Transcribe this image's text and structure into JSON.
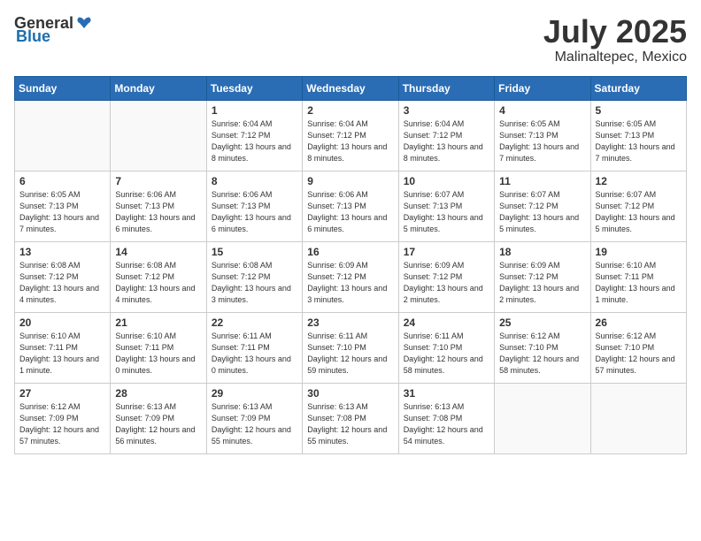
{
  "logo": {
    "general": "General",
    "blue": "Blue"
  },
  "title": "July 2025",
  "location": "Malinaltepec, Mexico",
  "weekdays": [
    "Sunday",
    "Monday",
    "Tuesday",
    "Wednesday",
    "Thursday",
    "Friday",
    "Saturday"
  ],
  "weeks": [
    [
      null,
      null,
      {
        "day": 1,
        "sunrise": "6:04 AM",
        "sunset": "7:12 PM",
        "daylight": "13 hours and 8 minutes."
      },
      {
        "day": 2,
        "sunrise": "6:04 AM",
        "sunset": "7:12 PM",
        "daylight": "13 hours and 8 minutes."
      },
      {
        "day": 3,
        "sunrise": "6:04 AM",
        "sunset": "7:12 PM",
        "daylight": "13 hours and 8 minutes."
      },
      {
        "day": 4,
        "sunrise": "6:05 AM",
        "sunset": "7:13 PM",
        "daylight": "13 hours and 7 minutes."
      },
      {
        "day": 5,
        "sunrise": "6:05 AM",
        "sunset": "7:13 PM",
        "daylight": "13 hours and 7 minutes."
      }
    ],
    [
      {
        "day": 6,
        "sunrise": "6:05 AM",
        "sunset": "7:13 PM",
        "daylight": "13 hours and 7 minutes."
      },
      {
        "day": 7,
        "sunrise": "6:06 AM",
        "sunset": "7:13 PM",
        "daylight": "13 hours and 6 minutes."
      },
      {
        "day": 8,
        "sunrise": "6:06 AM",
        "sunset": "7:13 PM",
        "daylight": "13 hours and 6 minutes."
      },
      {
        "day": 9,
        "sunrise": "6:06 AM",
        "sunset": "7:13 PM",
        "daylight": "13 hours and 6 minutes."
      },
      {
        "day": 10,
        "sunrise": "6:07 AM",
        "sunset": "7:13 PM",
        "daylight": "13 hours and 5 minutes."
      },
      {
        "day": 11,
        "sunrise": "6:07 AM",
        "sunset": "7:12 PM",
        "daylight": "13 hours and 5 minutes."
      },
      {
        "day": 12,
        "sunrise": "6:07 AM",
        "sunset": "7:12 PM",
        "daylight": "13 hours and 5 minutes."
      }
    ],
    [
      {
        "day": 13,
        "sunrise": "6:08 AM",
        "sunset": "7:12 PM",
        "daylight": "13 hours and 4 minutes."
      },
      {
        "day": 14,
        "sunrise": "6:08 AM",
        "sunset": "7:12 PM",
        "daylight": "13 hours and 4 minutes."
      },
      {
        "day": 15,
        "sunrise": "6:08 AM",
        "sunset": "7:12 PM",
        "daylight": "13 hours and 3 minutes."
      },
      {
        "day": 16,
        "sunrise": "6:09 AM",
        "sunset": "7:12 PM",
        "daylight": "13 hours and 3 minutes."
      },
      {
        "day": 17,
        "sunrise": "6:09 AM",
        "sunset": "7:12 PM",
        "daylight": "13 hours and 2 minutes."
      },
      {
        "day": 18,
        "sunrise": "6:09 AM",
        "sunset": "7:12 PM",
        "daylight": "13 hours and 2 minutes."
      },
      {
        "day": 19,
        "sunrise": "6:10 AM",
        "sunset": "7:11 PM",
        "daylight": "13 hours and 1 minute."
      }
    ],
    [
      {
        "day": 20,
        "sunrise": "6:10 AM",
        "sunset": "7:11 PM",
        "daylight": "13 hours and 1 minute."
      },
      {
        "day": 21,
        "sunrise": "6:10 AM",
        "sunset": "7:11 PM",
        "daylight": "13 hours and 0 minutes."
      },
      {
        "day": 22,
        "sunrise": "6:11 AM",
        "sunset": "7:11 PM",
        "daylight": "13 hours and 0 minutes."
      },
      {
        "day": 23,
        "sunrise": "6:11 AM",
        "sunset": "7:10 PM",
        "daylight": "12 hours and 59 minutes."
      },
      {
        "day": 24,
        "sunrise": "6:11 AM",
        "sunset": "7:10 PM",
        "daylight": "12 hours and 58 minutes."
      },
      {
        "day": 25,
        "sunrise": "6:12 AM",
        "sunset": "7:10 PM",
        "daylight": "12 hours and 58 minutes."
      },
      {
        "day": 26,
        "sunrise": "6:12 AM",
        "sunset": "7:10 PM",
        "daylight": "12 hours and 57 minutes."
      }
    ],
    [
      {
        "day": 27,
        "sunrise": "6:12 AM",
        "sunset": "7:09 PM",
        "daylight": "12 hours and 57 minutes."
      },
      {
        "day": 28,
        "sunrise": "6:13 AM",
        "sunset": "7:09 PM",
        "daylight": "12 hours and 56 minutes."
      },
      {
        "day": 29,
        "sunrise": "6:13 AM",
        "sunset": "7:09 PM",
        "daylight": "12 hours and 55 minutes."
      },
      {
        "day": 30,
        "sunrise": "6:13 AM",
        "sunset": "7:08 PM",
        "daylight": "12 hours and 55 minutes."
      },
      {
        "day": 31,
        "sunrise": "6:13 AM",
        "sunset": "7:08 PM",
        "daylight": "12 hours and 54 minutes."
      },
      null,
      null
    ]
  ]
}
